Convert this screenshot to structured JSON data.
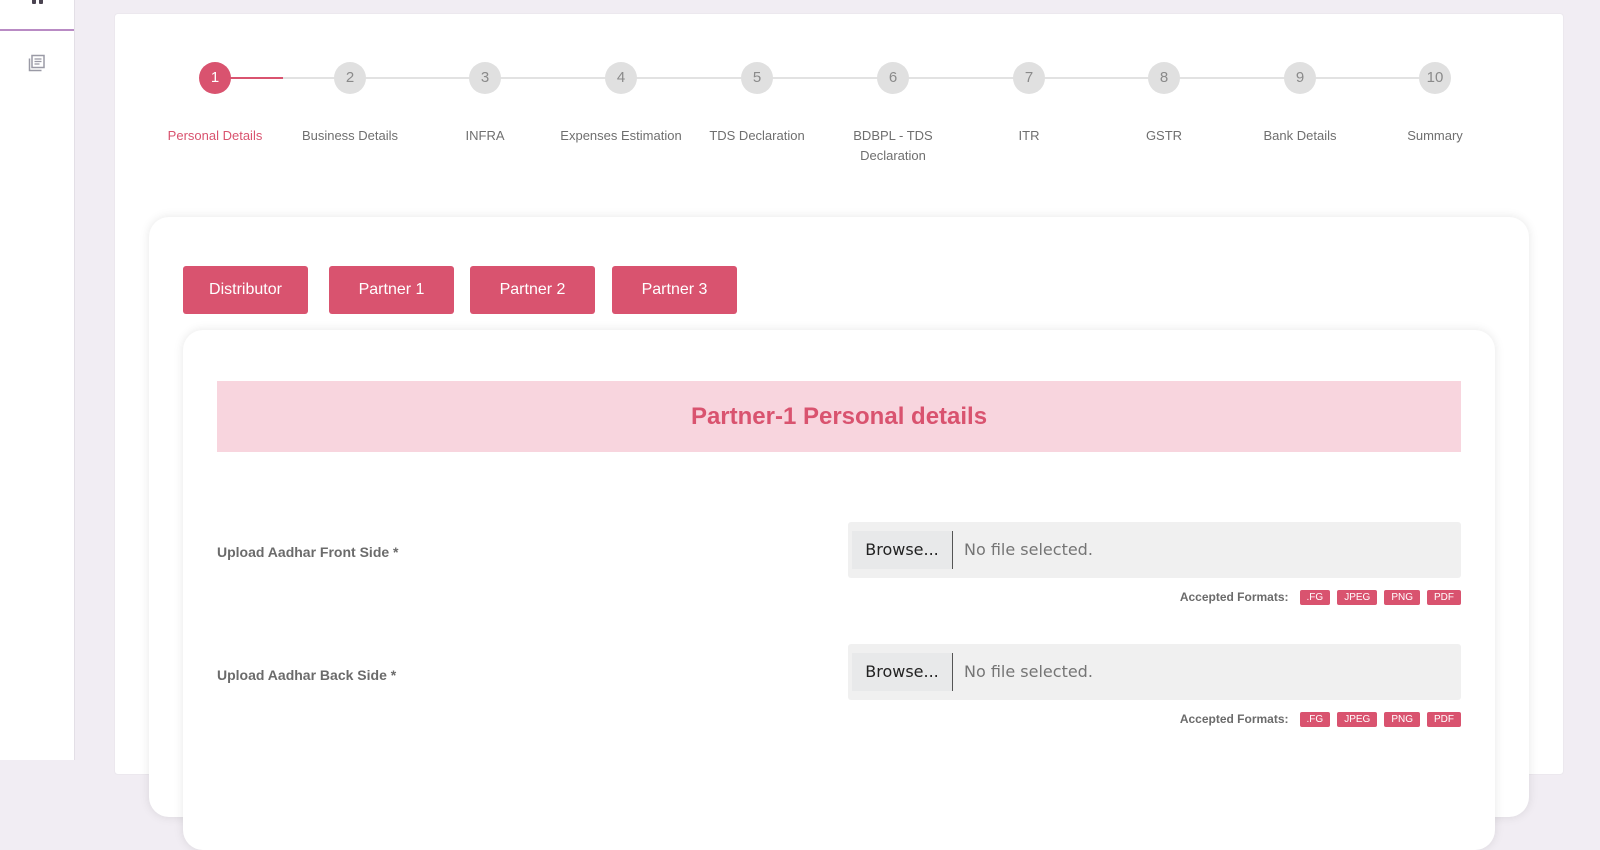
{
  "colors": {
    "accent": "#d9536f",
    "header_bg": "#f8d5de",
    "page_bg": "#f1edf3"
  },
  "sidebar": {
    "icons": [
      "pause-icon",
      "document-list-icon"
    ]
  },
  "stepper": {
    "active_index": 1,
    "steps": [
      {
        "number": "1",
        "label": "Personal Details"
      },
      {
        "number": "2",
        "label": "Business Details"
      },
      {
        "number": "3",
        "label": "INFRA"
      },
      {
        "number": "4",
        "label": "Expenses Estimation"
      },
      {
        "number": "5",
        "label": "TDS Declaration"
      },
      {
        "number": "6",
        "label": "BDBPL - TDS Declaration"
      },
      {
        "number": "7",
        "label": "ITR"
      },
      {
        "number": "8",
        "label": "GSTR"
      },
      {
        "number": "9",
        "label": "Bank Details"
      },
      {
        "number": "10",
        "label": "Summary"
      }
    ]
  },
  "tabs": [
    "Distributor",
    "Partner 1",
    "Partner 2",
    "Partner 3"
  ],
  "form": {
    "title": "Partner-1 Personal details",
    "fields": [
      {
        "label": "Upload Aadhar Front Side *",
        "browse_label": "Browse...",
        "status": "No file selected.",
        "formats_label": "Accepted Formats:",
        "formats": [
          ".FG",
          "JPEG",
          "PNG",
          "PDF"
        ]
      },
      {
        "label": "Upload Aadhar Back Side *",
        "browse_label": "Browse...",
        "status": "No file selected.",
        "formats_label": "Accepted Formats:",
        "formats": [
          ".FG",
          "JPEG",
          "PNG",
          "PDF"
        ]
      }
    ]
  }
}
